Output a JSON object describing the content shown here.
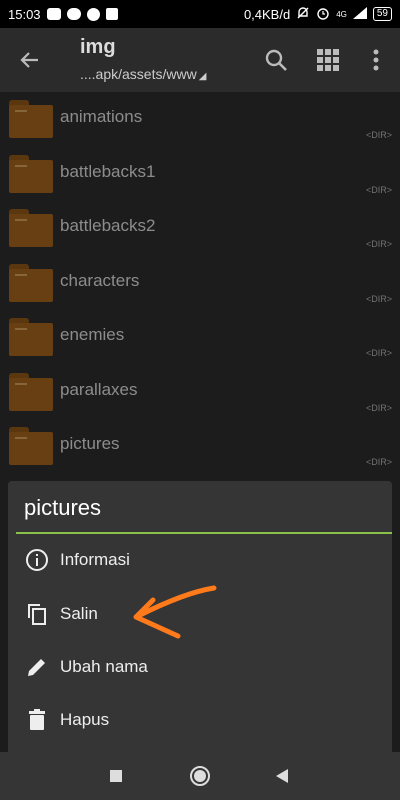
{
  "status_bar": {
    "time": "15:03",
    "net_speed": "0,4KB/d",
    "signal_label": "4G",
    "battery": "59"
  },
  "toolbar": {
    "title": "img",
    "path": "....apk/assets/www",
    "icons": [
      "back-arrow-icon",
      "search-icon",
      "grid-view-icon",
      "more-vert-icon"
    ]
  },
  "files": [
    {
      "name": "animations",
      "type": "<DIR>"
    },
    {
      "name": "battlebacks1",
      "type": "<DIR>"
    },
    {
      "name": "battlebacks2",
      "type": "<DIR>"
    },
    {
      "name": "characters",
      "type": "<DIR>"
    },
    {
      "name": "enemies",
      "type": "<DIR>"
    },
    {
      "name": "parallaxes",
      "type": "<DIR>"
    },
    {
      "name": "pictures",
      "type": "<DIR>"
    }
  ],
  "context_menu": {
    "title": "pictures",
    "items": [
      {
        "label": "Informasi",
        "icon": "info-icon"
      },
      {
        "label": "Salin",
        "icon": "copy-icon"
      },
      {
        "label": "Ubah nama",
        "icon": "edit-pencil-icon"
      },
      {
        "label": "Hapus",
        "icon": "delete-trash-icon"
      }
    ]
  },
  "colors": {
    "accent_divider": "#8bc34a",
    "annotation_arrow": "#ff7a1a",
    "folder": "#8b5419"
  }
}
